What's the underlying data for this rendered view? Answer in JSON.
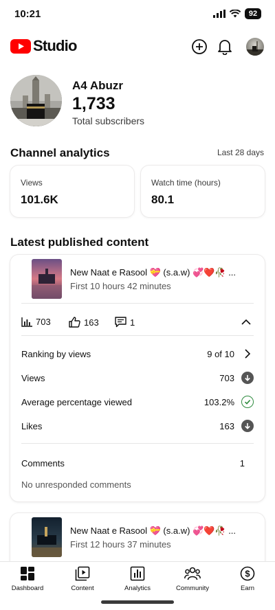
{
  "status_bar": {
    "time": "10:21",
    "battery": "92"
  },
  "header": {
    "app_name": "Studio",
    "icons": [
      "youtube-play-icon",
      "create-icon",
      "notifications-icon",
      "account-avatar"
    ]
  },
  "channel": {
    "name": "A4 Abuzr",
    "subscribers": "1,733",
    "subscribers_label": "Total subscribers"
  },
  "analytics": {
    "title": "Channel analytics",
    "period": "Last 28 days",
    "cards": [
      {
        "label": "Views",
        "value": "101.6K"
      },
      {
        "label": "Watch time (hours)",
        "value": "80.1"
      }
    ]
  },
  "latest": {
    "title": "Latest published content",
    "items": [
      {
        "title": "New Naat e Rasool 💝 (s.a.w) 💞❤️🥀 ...",
        "subtitle": "First 10 hours 42 minutes",
        "views": "703",
        "likes": "163",
        "comments_count": "1",
        "details": [
          {
            "label": "Ranking by views",
            "value": "9 of 10",
            "icon": "chevron-right-icon"
          },
          {
            "label": "Views",
            "value": "703",
            "icon": "arrow-down-circle-icon"
          },
          {
            "label": "Average percentage viewed",
            "value": "103.2%",
            "icon": "check-circle-icon"
          },
          {
            "label": "Likes",
            "value": "163",
            "icon": "arrow-down-circle-icon"
          }
        ],
        "comments_label": "Comments",
        "comments_value": "1",
        "comments_note": "No unresponded comments"
      },
      {
        "title": "New Naat e Rasool 💝 (s.a.w) 💞❤️🥀 ...",
        "subtitle": "First 12 hours 37 minutes"
      }
    ]
  },
  "bottom_nav": [
    {
      "label": "Dashboard",
      "icon": "dashboard-icon",
      "active": true
    },
    {
      "label": "Content",
      "icon": "content-icon"
    },
    {
      "label": "Analytics",
      "icon": "analytics-icon"
    },
    {
      "label": "Community",
      "icon": "community-icon"
    },
    {
      "label": "Earn",
      "icon": "earn-icon"
    }
  ],
  "colors": {
    "brand_red": "#ff0000",
    "success_green": "#2e8b3e",
    "text": "#0f0f0f",
    "muted": "#555555"
  }
}
